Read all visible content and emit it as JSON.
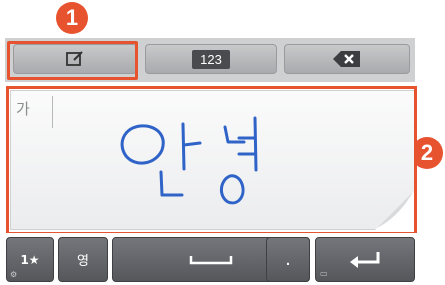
{
  "badges": {
    "one": "1",
    "two": "2"
  },
  "toolbar": {
    "edit_icon": "edit-icon",
    "num_label": "123",
    "backspace_icon": "backspace-icon"
  },
  "handwriting": {
    "mode_label": "가",
    "ink_color": "#2f63c8",
    "stroke_text": "안녕"
  },
  "keyboard": {
    "symbol_label": "1★",
    "lang_label": "영",
    "space_icon": "space-icon",
    "dot_label": ".",
    "enter_icon": "enter-icon",
    "settings_glyph": "⚙",
    "clipboard_glyph": "▭"
  },
  "colors": {
    "accent": "#e8532f",
    "key_dark": "#5f6165",
    "toolbar_bg": "#cfd0d2",
    "panel_bg": "#f4f5f6"
  }
}
